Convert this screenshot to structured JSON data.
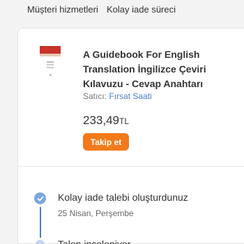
{
  "top_nav": {
    "customer_service": "Müşteri hizmetleri",
    "easy_return_process": "Kolay iade süreci"
  },
  "product": {
    "title": "A Guidebook For English Translation İngilizce Çeviri Kılavuzu - Cevap Anahtarı",
    "seller_label": "Satıcı:",
    "seller_name": "Fırsat Saati",
    "price": "233,49",
    "currency": "TL",
    "follow_label": "Takip et"
  },
  "timeline": {
    "steps": [
      {
        "title": "Kolay iade talebi oluşturdunuz",
        "date": "25 Nisan, Perşembe",
        "status": "done"
      },
      {
        "title": "Talep inceleniyor",
        "status": "pending"
      }
    ]
  },
  "colors": {
    "accent": "#f27a1a",
    "link": "#4a7cc7",
    "check": "#7aa7e0"
  },
  "icons": {
    "step_done": "check-circle-icon",
    "step_pending": "circle-icon"
  }
}
